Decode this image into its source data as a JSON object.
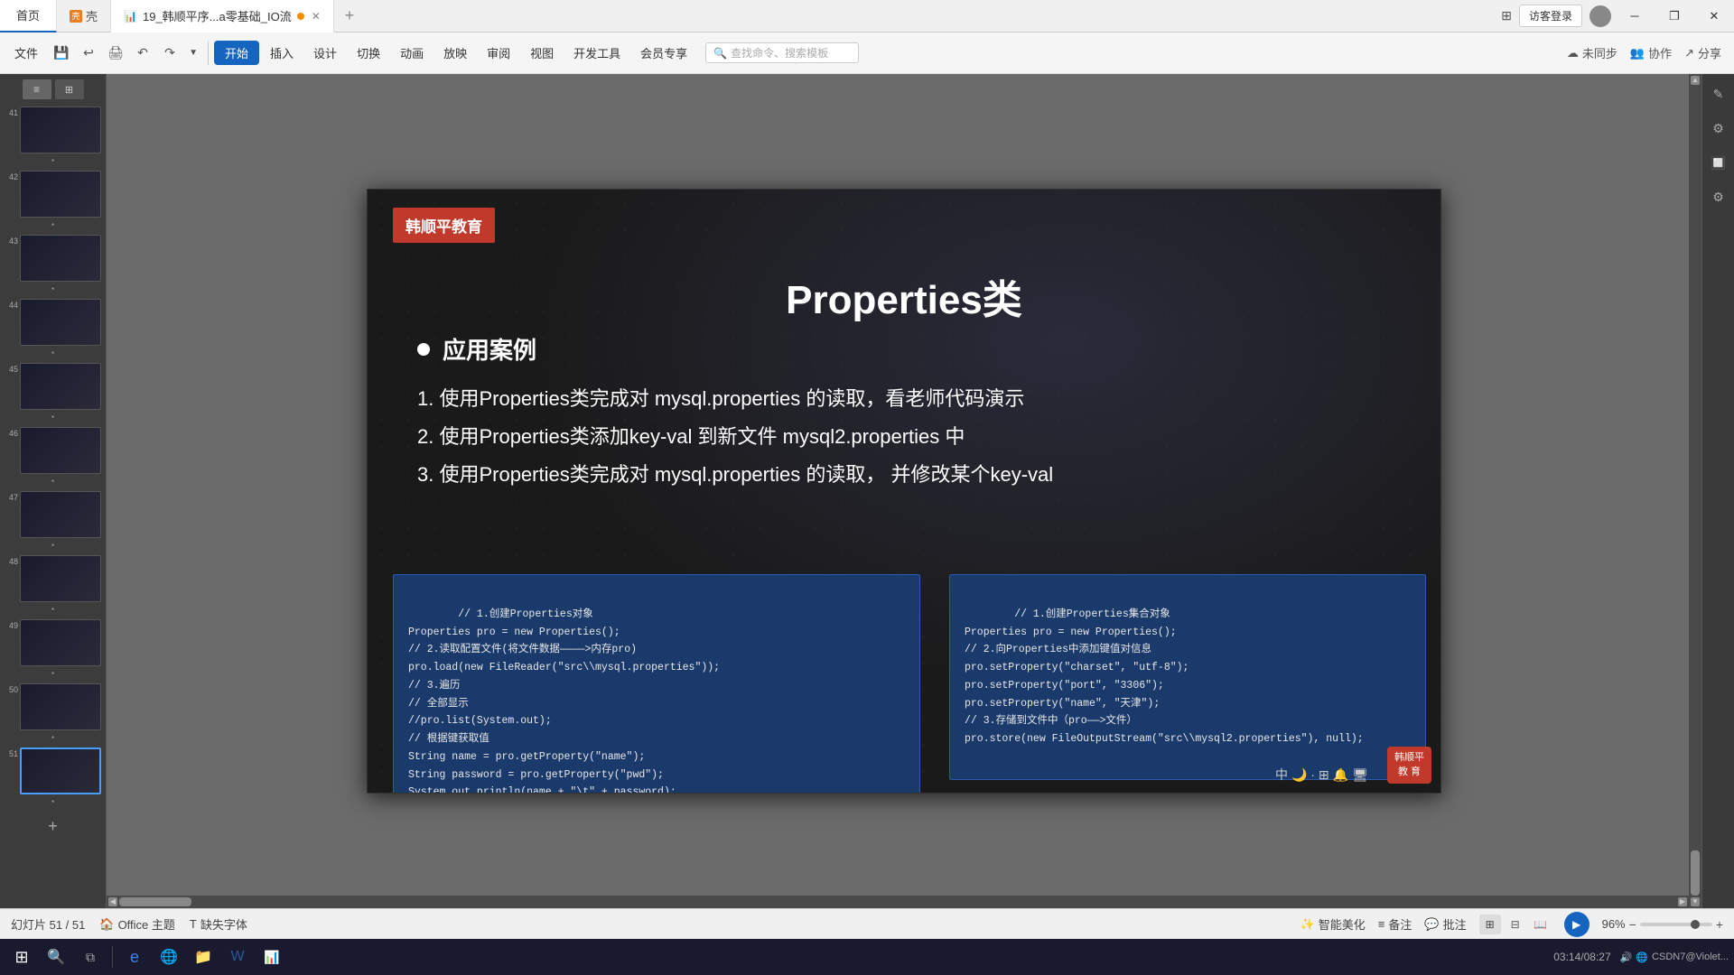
{
  "titlebar": {
    "tab_home": "首页",
    "tab_shell": "壳",
    "tab_presentation": "19_韩顺平序...a零基础_IO流",
    "btn_login": "访客登录",
    "icon_windows": "⊞",
    "icon_minimize": "─",
    "icon_restore": "❐",
    "icon_close": "✕"
  },
  "toolbar": {
    "file_btn": "文件",
    "open_btn": "开始",
    "insert_btn": "插入",
    "design_btn": "设计",
    "transition_btn": "切换",
    "animation_btn": "动画",
    "present_btn": "放映",
    "review_btn": "审阅",
    "view_btn": "视图",
    "devtools_btn": "开发工具",
    "member_btn": "会员专享",
    "search_placeholder": "查找命令、搜索模板",
    "sync_btn": "未同步",
    "collab_btn": "协作",
    "share_btn": "分享"
  },
  "slide": {
    "brand": "韩顺平教育",
    "title": "Properties类",
    "bullet_label": "应用案例",
    "item1": "1. 使用Properties类完成对 mysql.properties 的读取，看老师代码演示",
    "item2": "2. 使用Properties类添加key-val 到新文件 mysql2.properties 中",
    "item3": "3. 使用Properties类完成对 mysql.properties 的读取，  并修改某个key-val",
    "code_left": "// 1.创建Properties对象\nProperties pro = new Properties();\n// 2.读取配置文件(将文件数据————>内存pro)\npro.load(new FileReader(\"src\\\\mysql.properties\"));\n// 3.遍历\n// 全部显示\n//pro.list(System.out);\n// 根据键获取值\nString name = pro.getProperty(\"name\");\nString password = pro.getProperty(\"pwd\");\nSystem.out.println(name + \"\\t\" + password);",
    "code_right": "// 1.创建Properties集合对象\nProperties pro = new Properties();\n// 2.向Properties中添加键值对信息\npro.setProperty(\"charset\", \"utf-8\");\npro.setProperty(\"port\", \"3306\");\npro.setProperty(\"name\", \"天津\");\n// 3.存储到文件中（pro——>文件）\npro.store(new FileOutputStream(\"src\\\\mysql2.properties\"), null);"
  },
  "slides": {
    "thumbnails": [
      {
        "num": "41",
        "star": "*"
      },
      {
        "num": "42",
        "star": "*"
      },
      {
        "num": "43",
        "star": "*"
      },
      {
        "num": "44",
        "star": "*"
      },
      {
        "num": "45",
        "star": "*"
      },
      {
        "num": "46",
        "star": "*"
      },
      {
        "num": "47",
        "star": "*"
      },
      {
        "num": "48",
        "star": "*"
      },
      {
        "num": "49",
        "star": "*"
      },
      {
        "num": "50",
        "star": "*"
      },
      {
        "num": "51",
        "star": "*",
        "active": true
      }
    ]
  },
  "statusbar": {
    "slide_count": "幻灯片 51 / 51",
    "theme": "Office 主题",
    "missing_font": "缺失字体",
    "smart_beautify": "智能美化",
    "notes": "备注",
    "comments": "批注",
    "zoom_level": "96%",
    "play_btn": "▶"
  },
  "overlay": {
    "brand_text": "韩顺平\n教  育"
  },
  "taskbar": {
    "time": "03:14/08:27",
    "system_tray": "CSDN7@Violet..."
  }
}
